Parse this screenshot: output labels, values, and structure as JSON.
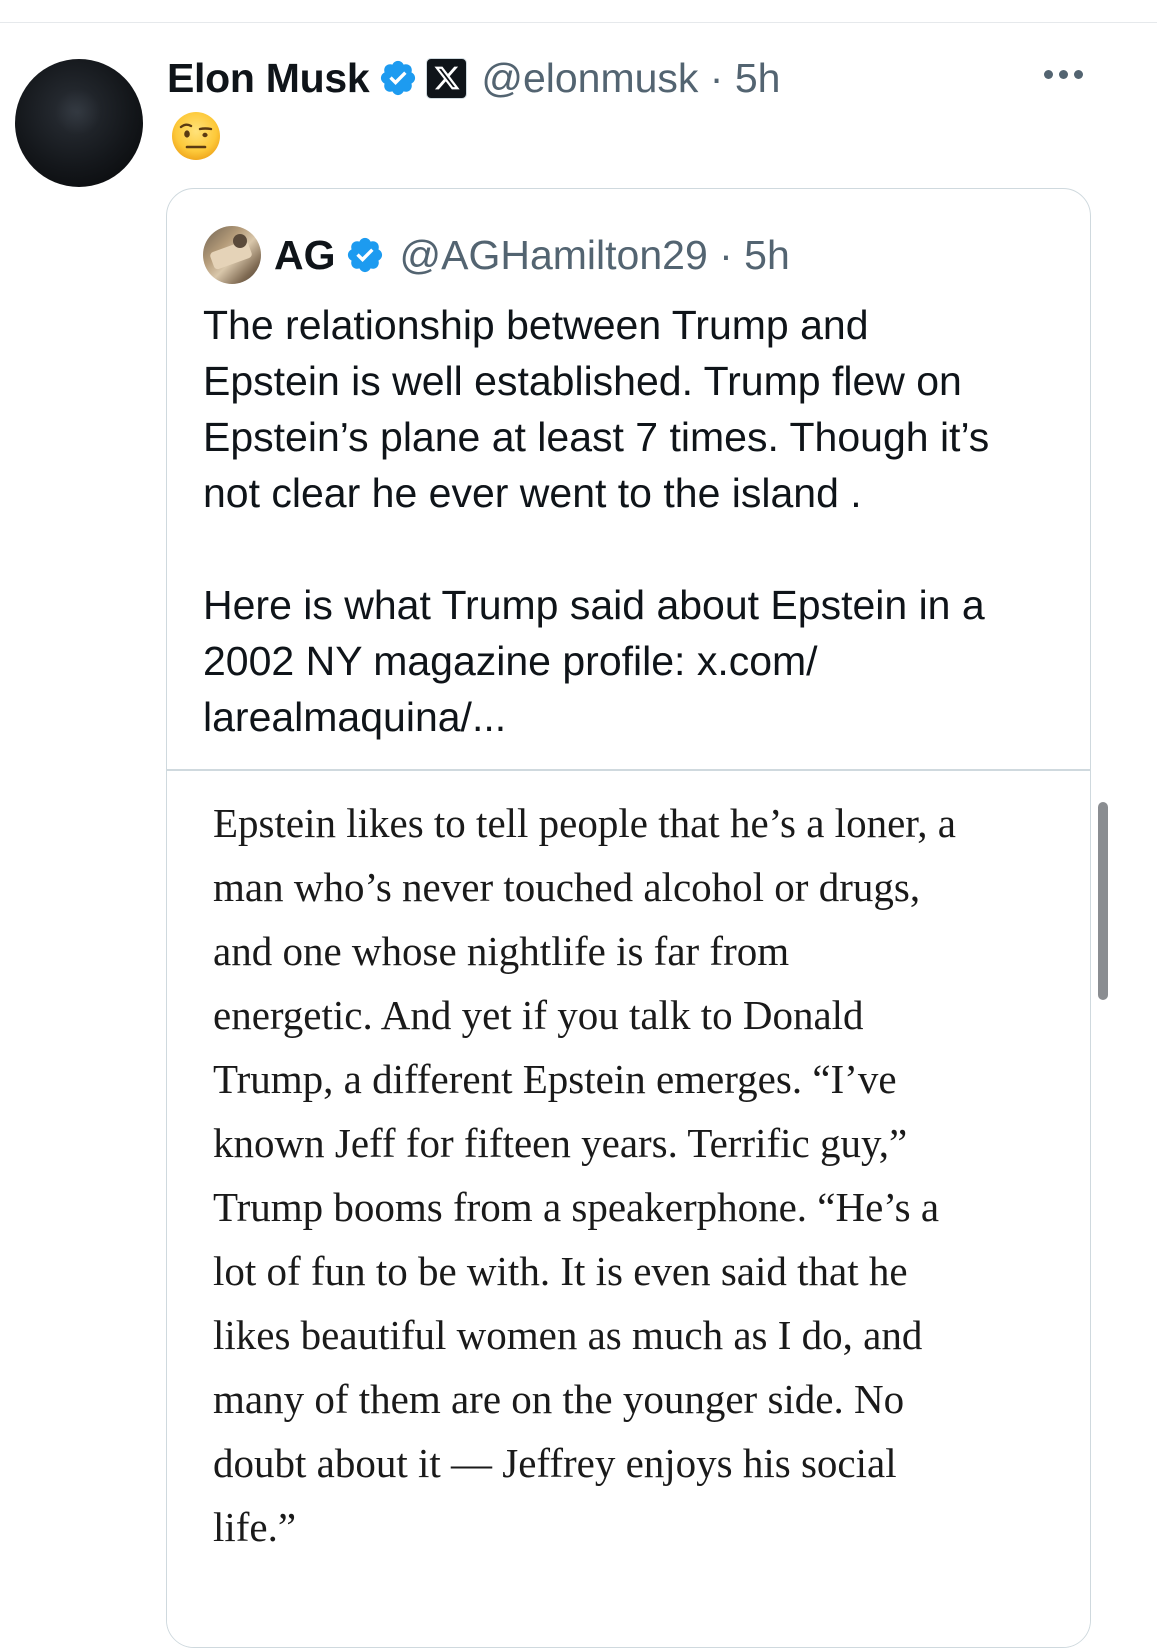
{
  "post": {
    "author_name": "Elon Musk",
    "handle_time": "@elonmusk · 5h",
    "emoji": "🤨",
    "more_icon": "more-horizontal-icon"
  },
  "quoted_post": {
    "author_name": "AG",
    "handle_time": "@AGHamilton29 · 5h",
    "text": "The relationship between Trump and\nEpstein is well established. Trump flew on\nEpstein’s plane at least 7 times. Though it’s\nnot clear he ever went to the island .\n\nHere is what Trump said about Epstein in a\n2002 NY magazine profile: x.com/\nlarealmaquina/...",
    "image_text": "Epstein likes to tell people that he’s a loner, a\nman who’s never touched alcohol or drugs,\nand one whose nightlife is far from\nenergetic. And yet if you talk to Donald\nTrump, a different Epstein emerges. “I’ve\nknown Jeff for fifteen years. Terrific guy,”\nTrump booms from a speakerphone. “He’s a\nlot of fun to be with. It is even said that he\nlikes beautiful women as much as I do, and\nmany of them are on the younger side. No\ndoubt about it — Jeffrey enjoys his social\nlife.”"
  },
  "colors": {
    "verified_blue": "#1d9bf0",
    "text_primary": "#0f1419",
    "text_secondary": "#536471",
    "border": "#cfd9de"
  }
}
